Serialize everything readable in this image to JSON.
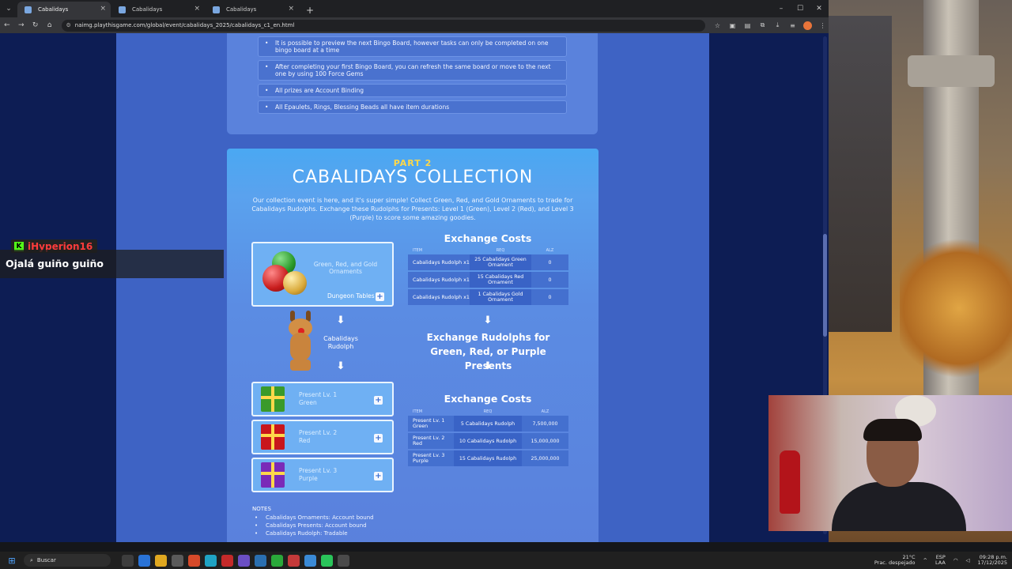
{
  "browser": {
    "tabs": [
      {
        "title": "Cabalidays"
      },
      {
        "title": "Cabalidays"
      },
      {
        "title": "Cabalidays"
      }
    ],
    "url": "naimg.playthisgame.com/global/event/cabalidays_2025/cabalidays_c1_en.html"
  },
  "part1_rules": [
    "It is possible to preview the next Bingo Board, however tasks can only be completed on one bingo board at a time",
    "After completing your first Bingo Board, you can refresh the same board or move to the next one by using 100 Force Gems",
    "All prizes are Account Binding",
    "All Epaulets, Rings, Blessing Beads all have item durations"
  ],
  "part2": {
    "part_label": "PART 2",
    "title": "CABALIDAYS COLLECTION",
    "intro": "Our collection event is here, and it's super simple! Collect Green, Red, and Gold Ornaments to trade for Cabalidays Rudolphs. Exchange these Rudolphs for Presents: Level 1 (Green), Level 2 (Red), and Level 3 (Purple) to score some amazing goodies.",
    "ornaments_label": "Green, Red, and Gold Ornaments",
    "dungeon_tables": "Dungeon Tables",
    "rudolph_label": "Cabalidays Rudolph",
    "presents": [
      {
        "label": "Present Lv. 1\nGreen",
        "color": "#3a9a2a"
      },
      {
        "label": "Present Lv. 2\nRed",
        "color": "#c8161c"
      },
      {
        "label": "Present Lv. 3\nPurple",
        "color": "#7a2ab8"
      }
    ],
    "exchange_costs_heading": "Exchange Costs",
    "table_headers": {
      "item": "ITEM",
      "req": "REQ",
      "alz": "ALZ"
    },
    "table1": [
      {
        "item": "Cabalidays Rudolph x1",
        "req": "25 Cabalidays Green Ornament",
        "alz": "0"
      },
      {
        "item": "Cabalidays Rudolph x1",
        "req": "15 Cabalidays Red Ornament",
        "alz": "0"
      },
      {
        "item": "Cabalidays Rudolph x1",
        "req": "1 Cabalidays Gold Ornament",
        "alz": "0"
      }
    ],
    "exchange_rudolphs_title": "Exchange Rudolphs for Green, Red, or Purple Presents",
    "table2": [
      {
        "item": "Present Lv. 1 Green",
        "req": "5 Cabalidays Rudolph",
        "alz": "7,500,000"
      },
      {
        "item": "Present Lv. 2 Red",
        "req": "10 Cabalidays Rudolph",
        "alz": "15,000,000"
      },
      {
        "item": "Present Lv. 3 Purple",
        "req": "15 Cabalidays Rudolph",
        "alz": "25,000,000"
      }
    ],
    "notes_label": "NOTES",
    "notes": [
      "Cabalidays Ornaments: Account bound",
      "Cabalidays Presents: Account bound",
      "Cabalidays Rudolph: Tradable"
    ]
  },
  "chat": {
    "username": "iHyperion16",
    "message": "Ojalá guiño guiño",
    "badge": "K"
  },
  "taskbar": {
    "search_placeholder": "Buscar",
    "weather": "21°C",
    "weather_desc": "Prac. despejado",
    "lang": "ESP",
    "lang2": "LAA",
    "time": "09:28 p.m.",
    "date": "17/12/2025"
  }
}
